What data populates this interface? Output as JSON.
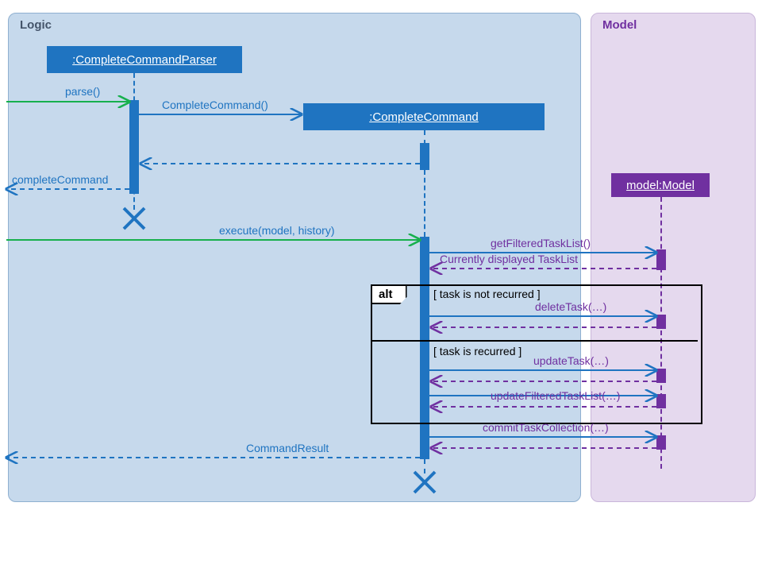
{
  "colors": {
    "logicFill": "#c6d9ec",
    "logicBorder": "#8fb0d0",
    "logicLabel": "#44546a",
    "modelFill": "#e5d9ee",
    "modelBorder": "#c9b6da",
    "modelLabel": "#7030a0",
    "blue": "#1f74c1",
    "purple": "#7030a0",
    "green": "#17b04d"
  },
  "frames": {
    "logic": {
      "label": "Logic"
    },
    "model": {
      "label": "Model"
    }
  },
  "boxes": {
    "parser": ":CompleteCommandParser",
    "command": ":CompleteCommand",
    "model": "model:Model"
  },
  "messages": {
    "parse": "parse()",
    "completeCommandCtor": "CompleteCommand()",
    "completeCommandReturn": "completeCommand",
    "execute": "execute(model, history)",
    "getFiltered": "getFilteredTaskList()",
    "currentlyDisplayed": "Currently displayed TaskList",
    "deleteTask": "deleteTask(…)",
    "updateTask": "updateTask(…)",
    "updateFilteredTaskList": "updateFilteredTaskList(…)",
    "commitTaskCollection": "commitTaskCollection(…)",
    "commandResult": "CommandResult"
  },
  "alt": {
    "label": "alt",
    "guard1": "[ task is not recurred ]",
    "guard2": "[ task is recurred ]"
  }
}
